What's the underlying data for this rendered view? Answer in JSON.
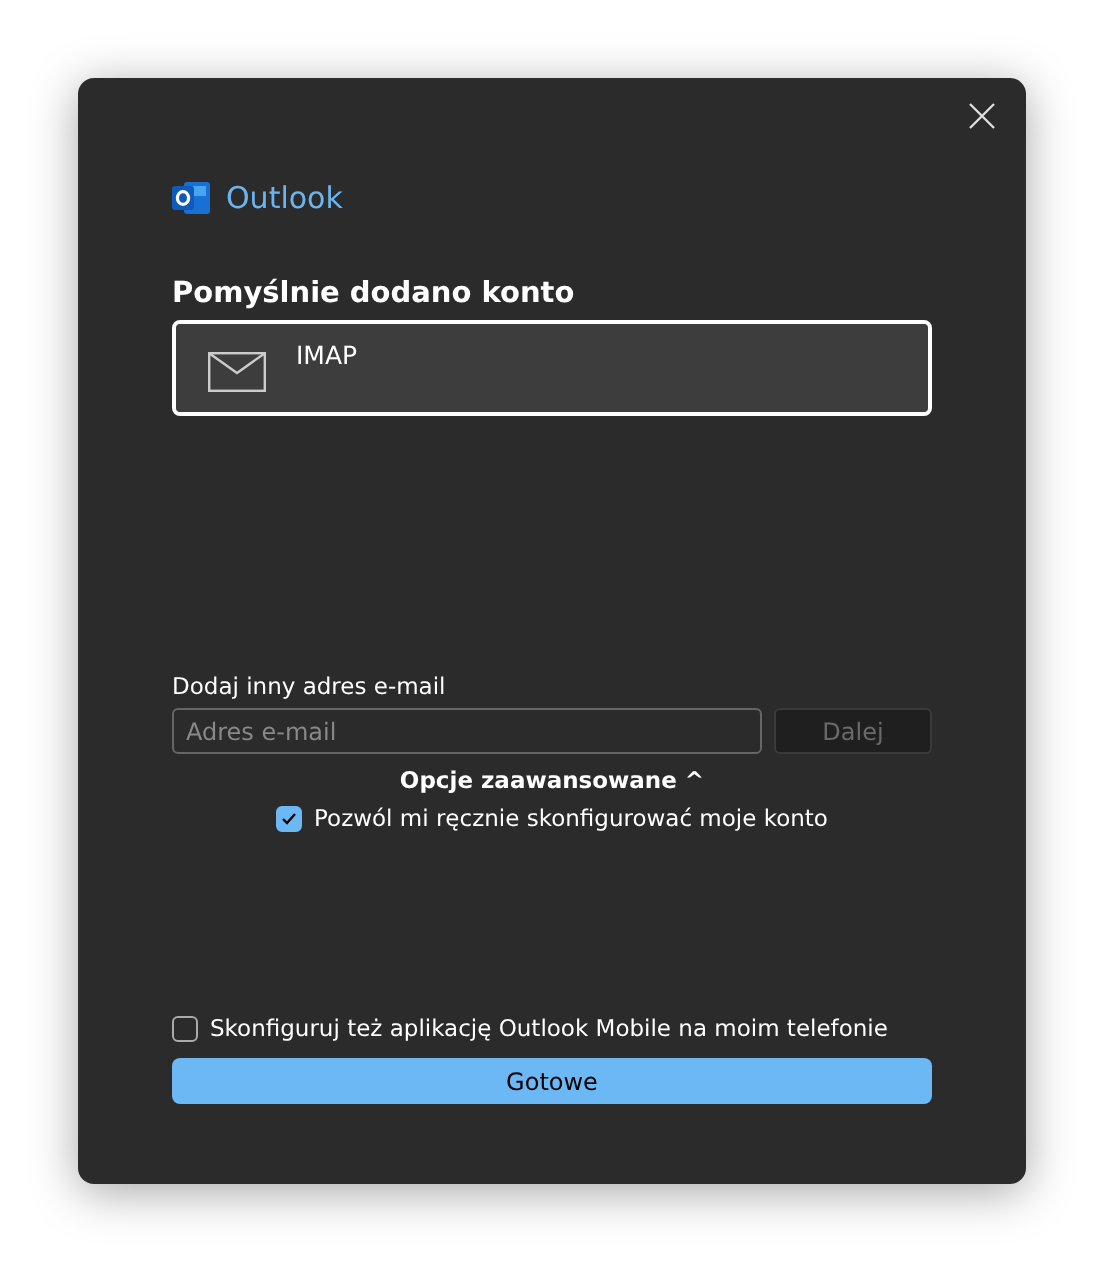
{
  "app": {
    "name": "Outlook"
  },
  "heading": "Pomyślnie dodano konto",
  "accounts": [
    {
      "label": "IMAP",
      "selected": true
    }
  ],
  "add_email": {
    "label": "Dodaj inny adres e-mail",
    "placeholder": "Adres e-mail",
    "button": {
      "label": "Dalej",
      "disabled": true
    }
  },
  "advanced": {
    "label": "Opcje zaawansowane",
    "chevron": "^",
    "options": [
      {
        "label": "Pozwól mi ręcznie skonfigurować moje konto",
        "checked": true
      }
    ]
  },
  "mobile_option": {
    "label": "Skonfiguruj też aplikację Outlook Mobile na moim telefonie",
    "checked": false
  },
  "done_button": "Gotowe"
}
